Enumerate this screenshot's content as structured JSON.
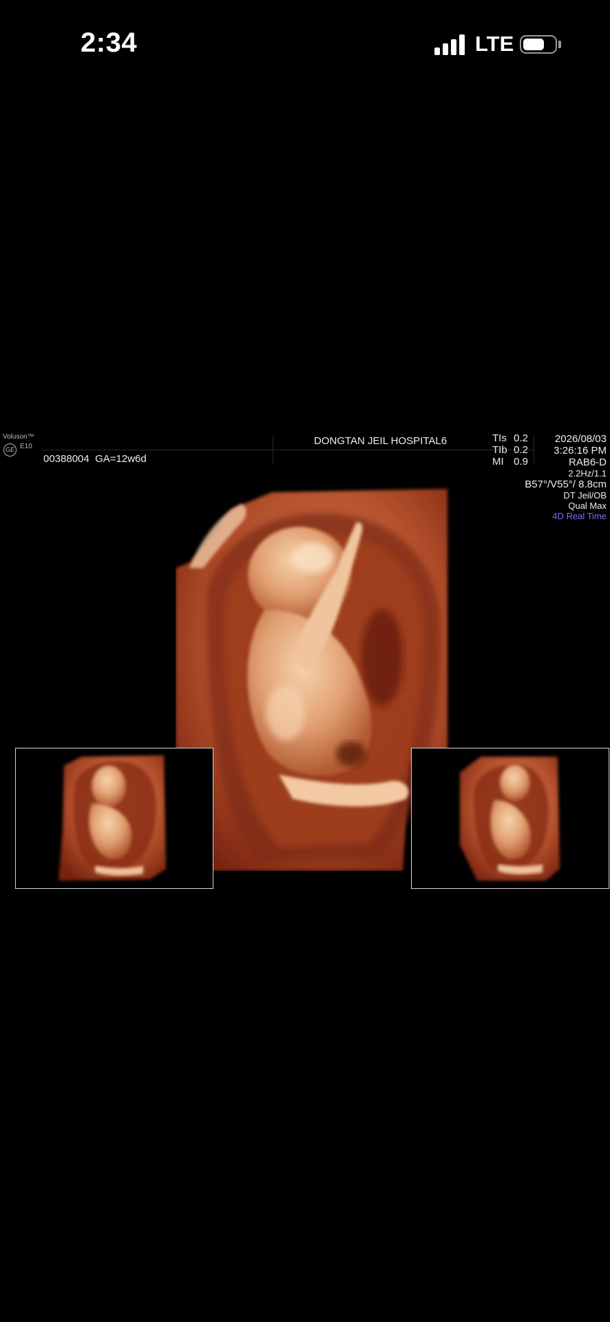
{
  "status_bar": {
    "time": "2:34",
    "network": "LTE",
    "icons": [
      "signal-icon",
      "battery-icon"
    ]
  },
  "ultrasound": {
    "brand": "Voluson™",
    "logo": "GE",
    "model": "E10",
    "hospital": "DONGTAN JEIL HOSPITAL6",
    "patient_line": "00388004  GA=12w6d",
    "acoustic": [
      {
        "label": "TIs",
        "value": "0.2"
      },
      {
        "label": "TIb",
        "value": "0.2"
      },
      {
        "label": "MI",
        "value": "0.9"
      }
    ],
    "date": "2026/08/03",
    "time": "3:26:16 PM",
    "probe": "RAB6-D",
    "frame_rate": "2.2Hz/1.1",
    "angles": "B57°/V55°/ 8.8cm",
    "preset": "DT Jeil/OB",
    "quality": "Qual Max",
    "mode": "4D Real Time"
  },
  "colors": {
    "background": "#000000",
    "tissue_dark": "#7a2410",
    "tissue_mid": "#c45a34",
    "tissue_light": "#f3c49c",
    "mode_accent": "#7f6bff"
  }
}
